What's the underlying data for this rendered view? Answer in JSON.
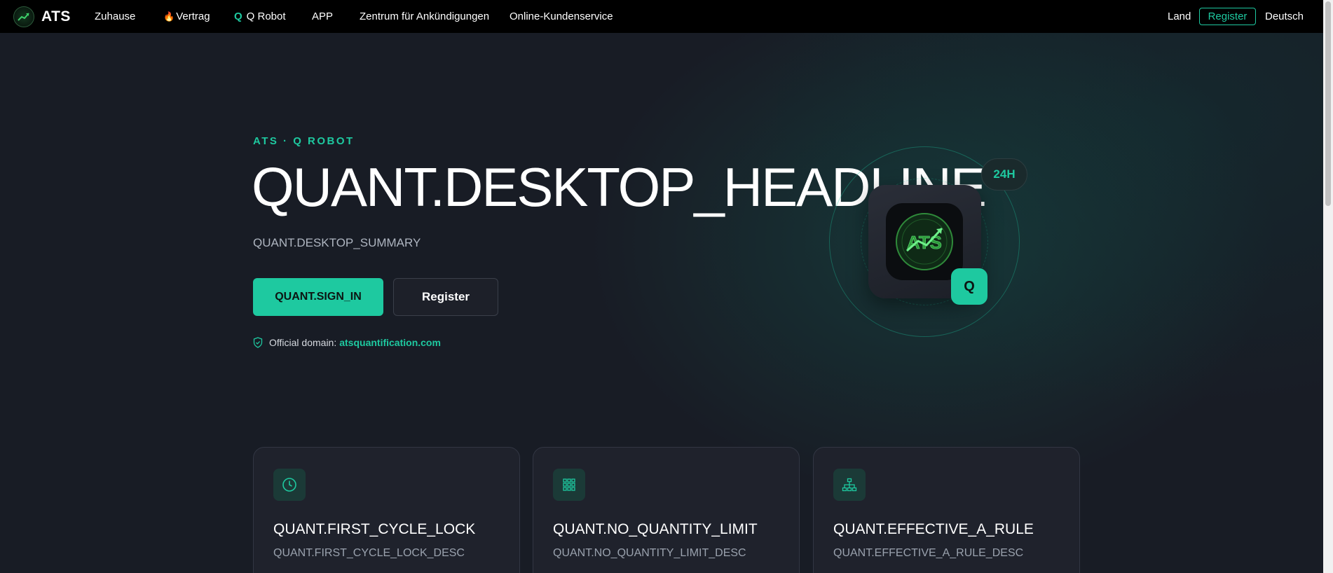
{
  "nav": {
    "brand": "ATS",
    "links": {
      "home": "Zuhause",
      "contract": "Vertrag",
      "robot_mark": "Q",
      "robot": "Q Robot",
      "app": "APP",
      "announcements": "Zentrum für Ankündigungen",
      "support": "Online-Kundenservice"
    },
    "land": "Land",
    "register": "Register",
    "language": "Deutsch"
  },
  "hero": {
    "eyebrow": "ATS · Q ROBOT",
    "headline": "QUANT.DESKTOP_HEADLINE",
    "summary": "QUANT.DESKTOP_SUMMARY",
    "primary_button": "QUANT.SIGN_IN",
    "secondary_button": "Register",
    "domain_label": "Official domain:",
    "domain_value": "atsquantification.com"
  },
  "illustration": {
    "badge": "24H",
    "q_badge": "Q",
    "app_logo_text": "ATS"
  },
  "features": [
    {
      "icon": "clock-icon",
      "title": "QUANT.FIRST_CYCLE_LOCK",
      "desc": "QUANT.FIRST_CYCLE_LOCK_DESC"
    },
    {
      "icon": "grid-icon",
      "title": "QUANT.NO_QUANTITY_LIMIT",
      "desc": "QUANT.NO_QUANTITY_LIMIT_DESC"
    },
    {
      "icon": "hierarchy-icon",
      "title": "QUANT.EFFECTIVE_A_RULE",
      "desc": "QUANT.EFFECTIVE_A_RULE_DESC"
    }
  ],
  "colors": {
    "accent": "#1ec9a0",
    "background": "#181c25",
    "nav_background": "#000000"
  }
}
